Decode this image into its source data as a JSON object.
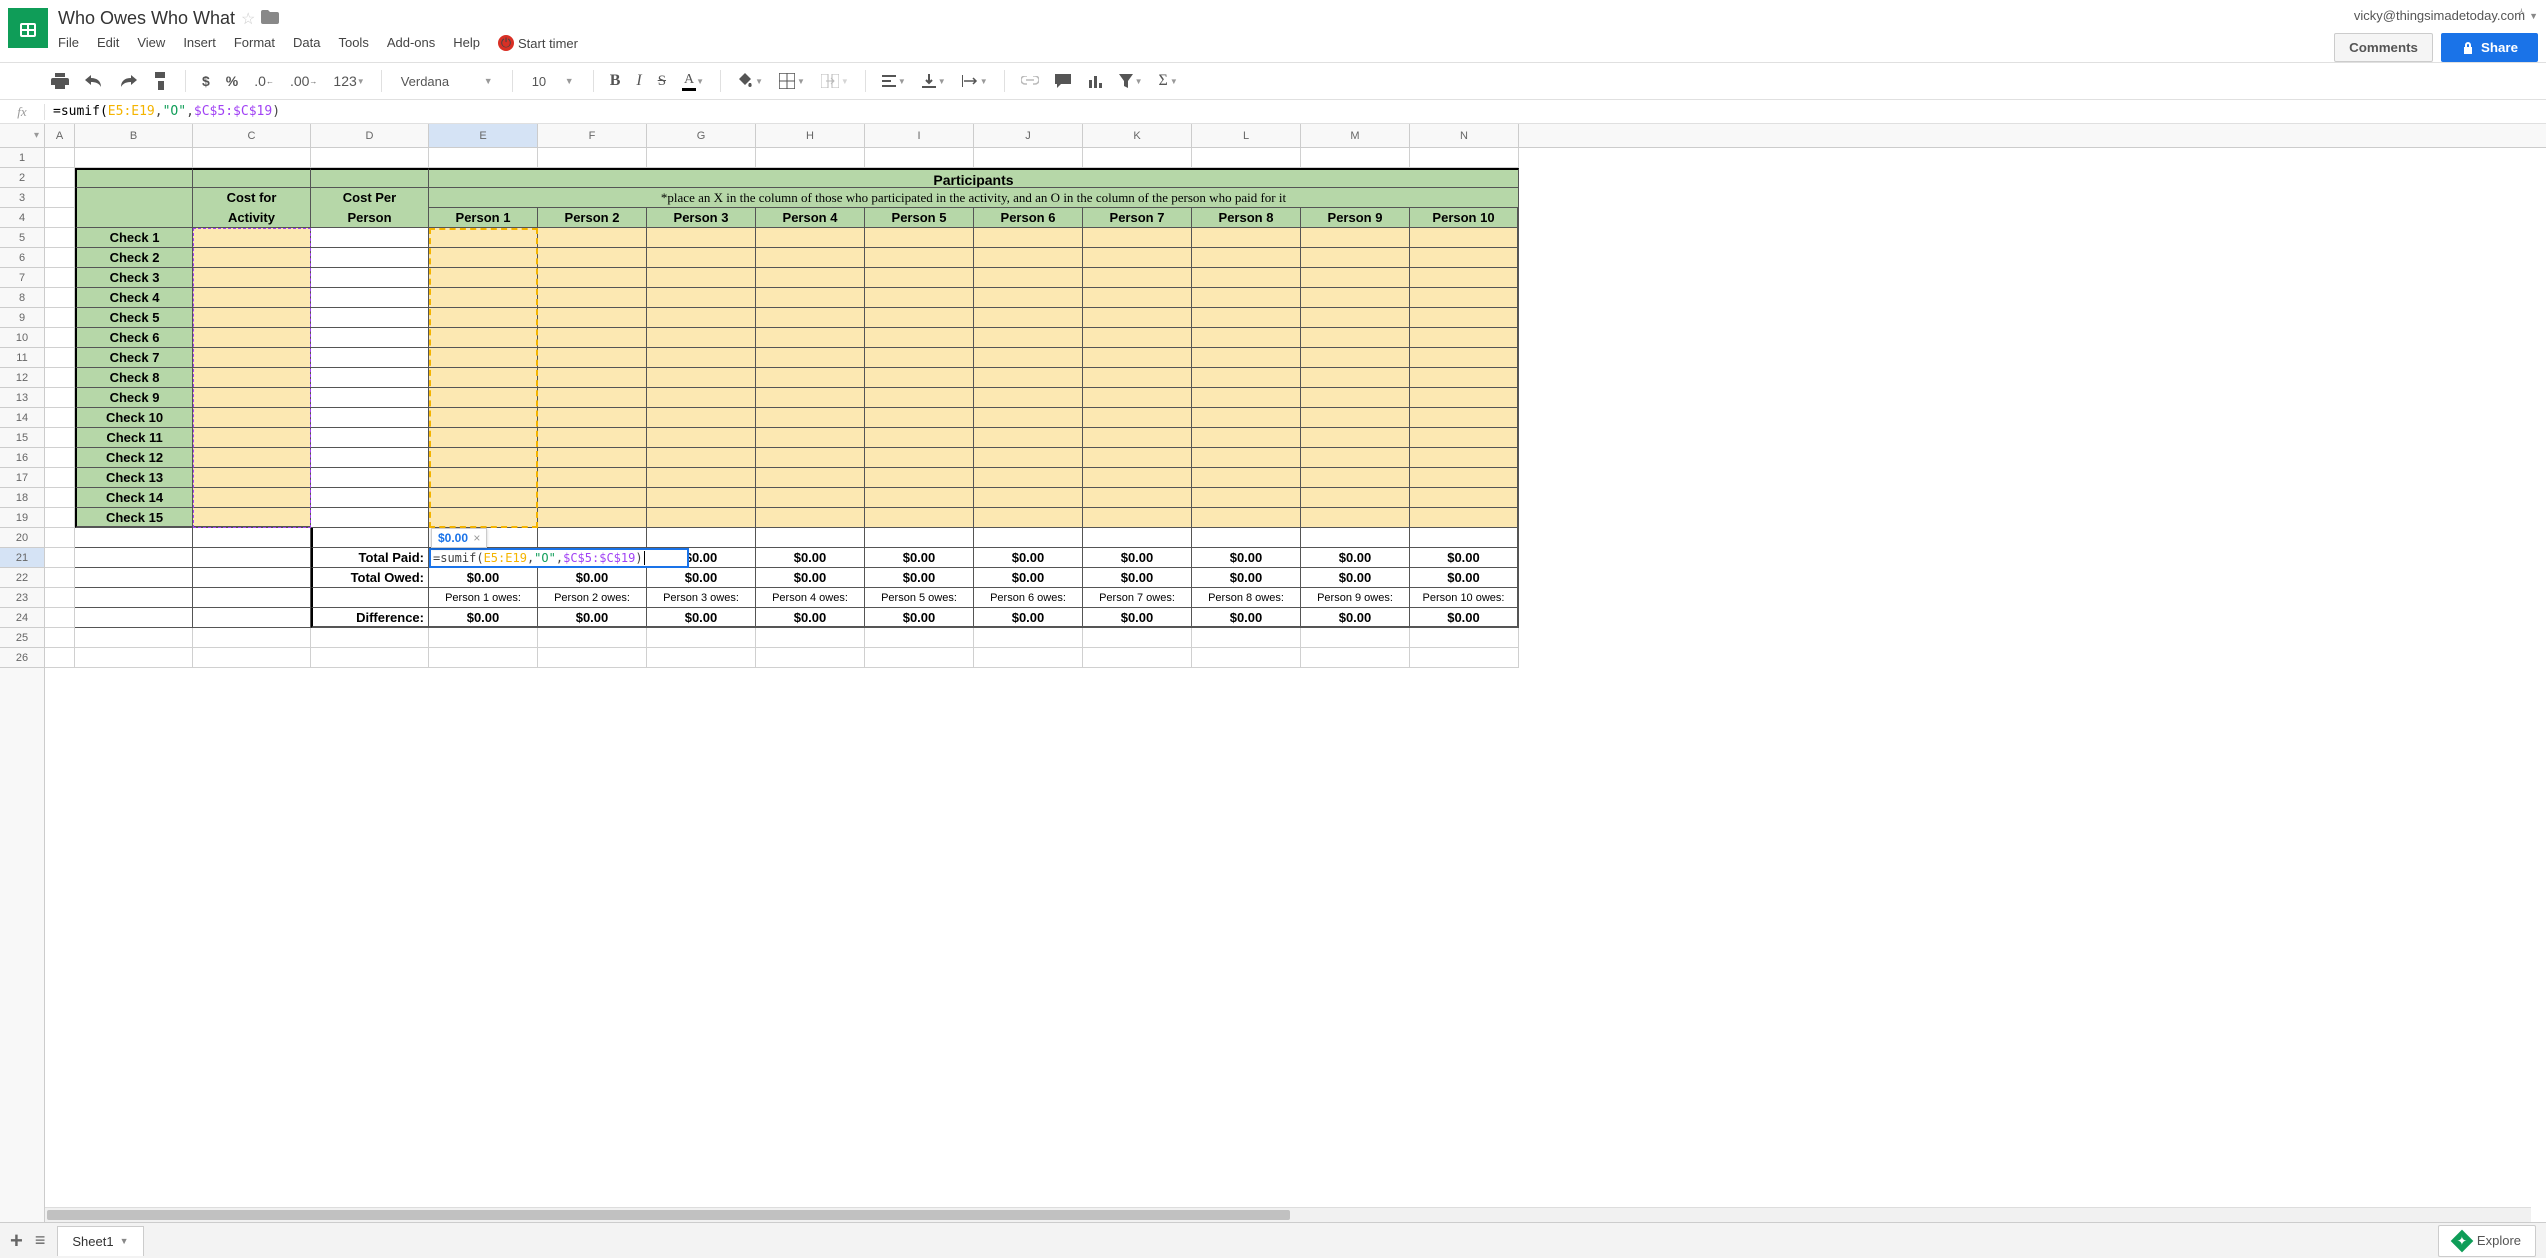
{
  "doc": {
    "title": "Who Owes Who What"
  },
  "user": {
    "email": "vicky@thingsimadetoday.com"
  },
  "buttons": {
    "comments": "Comments",
    "share": "Share",
    "explore": "Explore"
  },
  "menu": {
    "file": "File",
    "edit": "Edit",
    "view": "View",
    "insert": "Insert",
    "format": "Format",
    "data": "Data",
    "tools": "Tools",
    "addons": "Add-ons",
    "help": "Help",
    "timer": "Start timer"
  },
  "toolbar": {
    "font": "Verdana",
    "size": "10",
    "more": "123"
  },
  "formula": {
    "plain": "=sumif(E5:E19,\"O\",$C$5:$C$19)",
    "name": "=sumif(",
    "r1": "E5:E19",
    "c1": ",",
    "str": "\"O\"",
    "c2": ",",
    "r2": "$C$5:$C$19",
    "close": ")"
  },
  "result_tip": "$0.00",
  "cols": [
    "A",
    "B",
    "C",
    "D",
    "E",
    "F",
    "G",
    "H",
    "I",
    "J",
    "K",
    "L",
    "M",
    "N"
  ],
  "rows": [
    "1",
    "2",
    "3",
    "4",
    "5",
    "6",
    "7",
    "8",
    "9",
    "10",
    "11",
    "12",
    "13",
    "14",
    "15",
    "16",
    "17",
    "18",
    "19",
    "20",
    "21",
    "22",
    "23",
    "24",
    "25",
    "26"
  ],
  "sheet": {
    "participants_header": "Participants",
    "instruction": "*place an X in the column of those who participated in the activity, and an O in the column of the person who paid for it",
    "cost_activity_l1": "Cost for",
    "cost_activity_l2": "Activity",
    "cost_person_l1": "Cost Per",
    "cost_person_l2": "Person",
    "persons": [
      "Person 1",
      "Person 2",
      "Person 3",
      "Person 4",
      "Person 5",
      "Person 6",
      "Person 7",
      "Person 8",
      "Person 9",
      "Person 10"
    ],
    "checks": [
      "Check 1",
      "Check 2",
      "Check 3",
      "Check 4",
      "Check 5",
      "Check 6",
      "Check 7",
      "Check 8",
      "Check 9",
      "Check 10",
      "Check 11",
      "Check 12",
      "Check 13",
      "Check 14",
      "Check 15"
    ],
    "total_paid": "Total Paid:",
    "total_owed": "Total Owed:",
    "difference": "Difference:",
    "owes": [
      "Person 1 owes:",
      "Person 2 owes:",
      "Person 3 owes:",
      "Person 4 owes:",
      "Person 5 owes:",
      "Person 6 owes:",
      "Person 7 owes:",
      "Person 8 owes:",
      "Person 9 owes:",
      "Person 10 owes:"
    ],
    "zero": "$0.00"
  },
  "tabs": {
    "sheet1": "Sheet1"
  }
}
